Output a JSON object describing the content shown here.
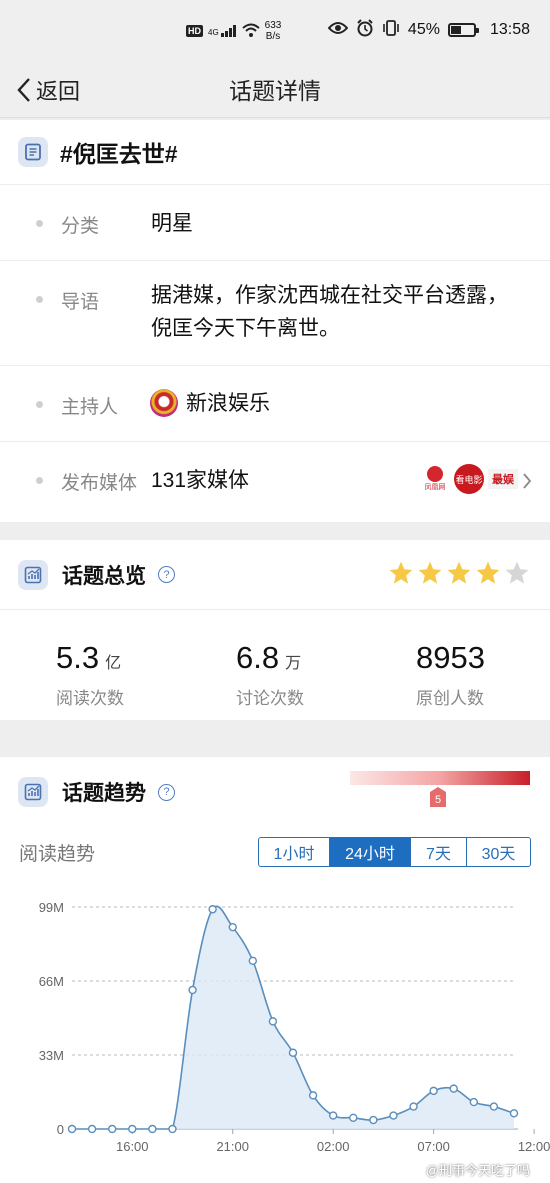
{
  "status_bar": {
    "hd": "HD",
    "net_type": "4G",
    "net_speed_value": "633",
    "net_speed_unit": "B/s",
    "battery_percent": 45,
    "battery_text": "45%",
    "time": "13:58"
  },
  "header": {
    "back_label": "返回",
    "title": "话题详情"
  },
  "topic": {
    "name": "#倪匡去世#",
    "rows": [
      {
        "label": "分类",
        "value": "明星"
      },
      {
        "label": "导语",
        "value": "据港媒，作家沈西城在社交平台透露，倪匡今天下午离世。"
      },
      {
        "label": "主持人",
        "value": "新浪娱乐"
      },
      {
        "label": "发布媒体",
        "value": "131家媒体"
      }
    ],
    "media_logos": [
      "凤凰网",
      "看电影",
      "最娱"
    ]
  },
  "overview": {
    "title": "话题总览",
    "rating": 4,
    "rating_max": 5,
    "star_color_on": "#f5c845",
    "star_color_off": "#d6d6d6",
    "stats": [
      {
        "number": "5.3",
        "unit": "亿",
        "label": "阅读次数"
      },
      {
        "number": "6.8",
        "unit": "万",
        "label": "讨论次数"
      },
      {
        "number": "8953",
        "unit": "",
        "label": "原创人数"
      }
    ]
  },
  "trend": {
    "title": "话题趋势",
    "heat_level": "5",
    "subtitle": "阅读趋势",
    "tabs": [
      "1小时",
      "24小时",
      "7天",
      "30天"
    ],
    "active_tab": "24小时",
    "accent": "#1d6ec0"
  },
  "chart_data": {
    "type": "area",
    "title": "",
    "xlabel": "",
    "ylabel": "",
    "y_ticks": [
      "0",
      "33M",
      "66M",
      "99M"
    ],
    "y_tick_values": [
      0,
      33,
      66,
      99
    ],
    "x_ticks": [
      "16:00",
      "21:00",
      "02:00",
      "07:00",
      "12:00"
    ],
    "x_tick_hours": [
      3,
      8,
      13,
      18,
      23
    ],
    "ylim": [
      0,
      99
    ],
    "grid": true,
    "line_color": "#5a8ebc",
    "fill_color": "#dbe8f6",
    "series": [
      {
        "x_hours": [
          0,
          1,
          2,
          3,
          4,
          5,
          6,
          7,
          8,
          9,
          10,
          11,
          12,
          13,
          14,
          15,
          16,
          17,
          18,
          19,
          20,
          21,
          22,
          23,
          24
        ],
        "values": [
          0,
          0,
          0,
          0,
          0,
          0,
          62,
          98,
          90,
          75,
          48,
          34,
          15,
          6,
          5,
          4,
          6,
          10,
          17,
          18,
          12,
          10,
          7,
          7,
          0
        ]
      }
    ],
    "x_hour_count": 22
  },
  "watermark": "@刑事今天吃了吗"
}
